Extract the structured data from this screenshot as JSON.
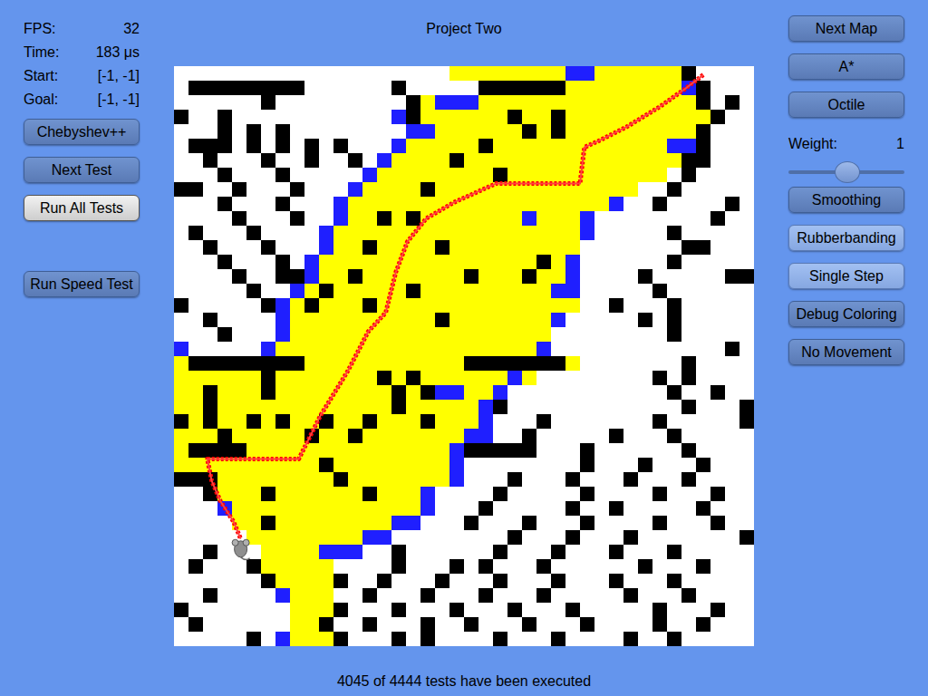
{
  "window": {
    "title": "Project Two"
  },
  "stats": [
    {
      "label": "FPS:",
      "value": "32"
    },
    {
      "label": "Time:",
      "value": "183 μs"
    },
    {
      "label": "Start:",
      "value": "[-1, -1]"
    },
    {
      "label": "Goal:",
      "value": "[-1, -1]"
    }
  ],
  "test_buttons": [
    {
      "label": "Chebyshev++",
      "active": false,
      "hovered": false
    },
    {
      "label": "Next Test",
      "active": false,
      "hovered": false
    },
    {
      "label": "Run All Tests",
      "active": false,
      "hovered": true
    }
  ],
  "speed_button": {
    "label": "Run Speed Test",
    "active": false,
    "hovered": false
  },
  "settings_buttons": [
    {
      "label": "Next Map",
      "active": false
    },
    {
      "label": "A*",
      "active": false
    },
    {
      "label": "Octile",
      "active": false
    }
  ],
  "weight": {
    "label": "Weight:",
    "value": "1",
    "level": 0.5
  },
  "toggles": [
    {
      "label": "Smoothing",
      "active": false
    },
    {
      "label": "Rubberbanding",
      "active": true
    },
    {
      "label": "Single Step",
      "active": true
    },
    {
      "label": "Debug Coloring",
      "active": false
    },
    {
      "label": "No Movement",
      "active": false
    }
  ],
  "map": {
    "rows": [
      "...................yyyyyyyybbyyyyyy#..",
      ".########......#.....######yyyyyyyyb#..",
      "......#.........#ybbbyyyyyyyyyyyyyyy#.#",
      "#..#...........b#yyyyyy#yy#yyyyyyyyyy#..",
      "...#.#.#........bbyyyyyy#y#yyyyyyyyy#..",
      ".###.#.#.#.#...byyyyy#yyyyyyyyyyyybb#...",
      "..#...#..#..#.byyyy#yyyyyyyyyyyyyyy##...",
      "...#...#.....byyyyyyyy#yyyyyyyyyyy.#....",
      "##..#...#...byyyy#yyyyyyyyyyyyyy..#.....",
      "...#...#...byyyyyyyyyyyyyyyyyyb..#....#..",
      "....#...#..byy#y#yyyyyyybyyyb........#.",
      ".#...#....byyyyyyyyyyyyyyyyyb.....#.....",
      "..#...#...byy#yyyy#yyyyyyyyy.......##...",
      "...#...#.byyyyyyyyyyyyyyy#yb......#.....",
      "....#..##byy#yyyyyyy#yyy#yyb....#.....##",
      ".....#..by#yyyyy#yyyyyyyyybb.....#.....",
      "#.....#by#yyy#yyyyyyyyyyyyyy..#...#.....",
      "..#....byyyyyyyyyy#yyyyyyyb.....#.#.....",
      "...#...byyyyyyyyyyyyyyyyyy........#.....",
      "b.....byyyyyyyyyyyyyyyyyyb............#.",
      "y########yyyyyyyyyyy#######y.......#....",
      "yyyyyy#yyyyyyy#y#yyyyyyby........#.#....",
      "yy#yyy#yyyyyyyy#y#bbyyb...........#..#..",
      "yy#yyyyyyyyyyyy#yyyyyb#............#...#",
      "#y#yy#y#yy#yy#yyy#yyyb...#.......#.....#",
      "yyy#yyyyy#yy#yyyyyyybb..#.....#...#.....",
      "y####yyyyyyyyyyyyyyb#####...#......#....",
      "yyyyyyyyyy#yyyyyyyyb........#...#...#...",
      "###yyyyyyyy#yyyyyyyb...#...#...#...#....",
      "..#yyy#yyyyyy#yyyb....#.....#....#...#..",
      "...byyyyyyyyyyyyyb...#.....#..#.....#...",
      "....yy#yyyyyyyybb...#...#...#....#...#..",
      ".....yyyyyyyybb........#...#...#.......#",
      "..#...yyyybbb..#......#...#...#...#.....",
      ".#...#yyyyy....#...#.#...#......#...#...",
      "......#yyyy#..#...#...#...#...#...#.....",
      "..#....byyy..#...#...#...#.....#...#....",
      "#.......yyy#...#...#...#...#.....#...#...",
      ".#......yy#..#...#..#...#...#....#..#...",
      ".....#.byyy#...#.#....#...#....#..#....."
    ],
    "path": [
      [
        36.5,
        0.6
      ],
      [
        35.2,
        1.6
      ],
      [
        33.5,
        2.8
      ],
      [
        31.2,
        4.2
      ],
      [
        29.4,
        5.1
      ],
      [
        28.3,
        5.6
      ],
      [
        28,
        8.1
      ],
      [
        22.2,
        8.1
      ],
      [
        19.3,
        9.4
      ],
      [
        17.4,
        10.5
      ],
      [
        16.1,
        12.1
      ],
      [
        15.3,
        14.2
      ],
      [
        14.6,
        17
      ],
      [
        13.4,
        18.3
      ],
      [
        12,
        21
      ],
      [
        10.1,
        24.1
      ],
      [
        8.6,
        27.1
      ],
      [
        2.3,
        27.1
      ],
      [
        2.6,
        28.6
      ],
      [
        3.2,
        30
      ],
      [
        4.1,
        31.4
      ],
      [
        4.6,
        32.6
      ]
    ],
    "agent": [
      4.6,
      33.3
    ]
  },
  "status": "4045 of 4444 tests have been executed"
}
